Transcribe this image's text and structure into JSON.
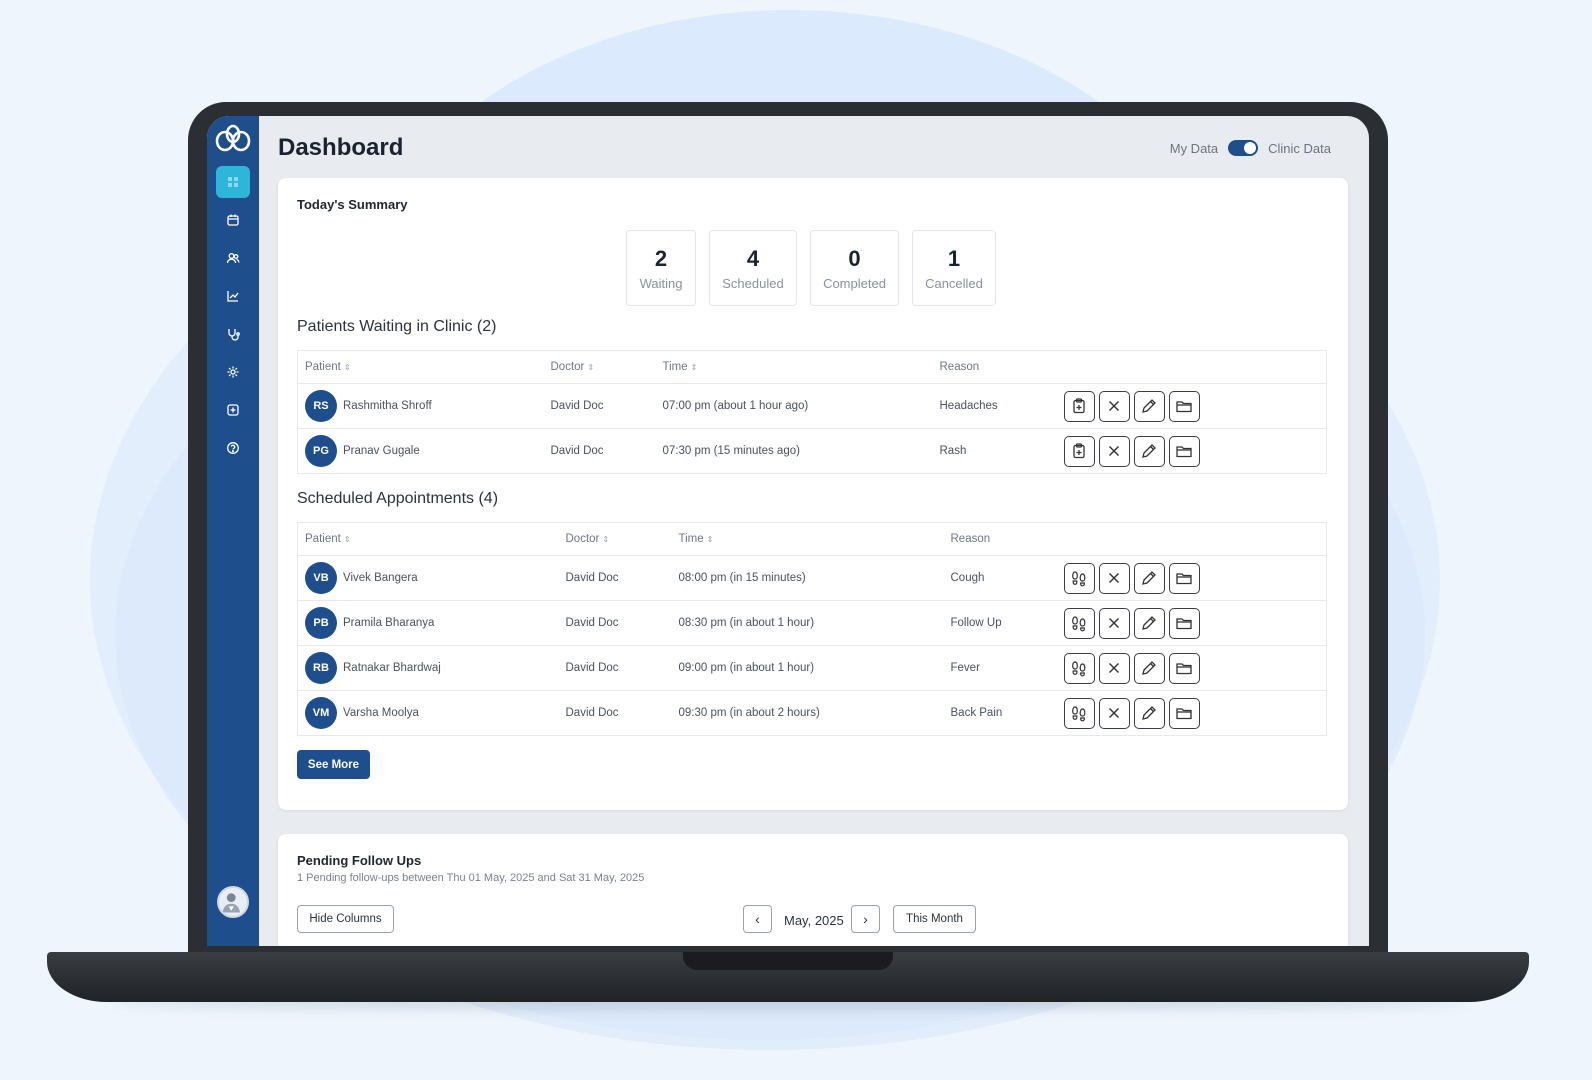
{
  "header": {
    "title": "Dashboard",
    "toggle_left": "My Data",
    "toggle_right": "Clinic Data"
  },
  "summary": {
    "title": "Today's Summary",
    "stats": [
      {
        "value": "2",
        "label": "Waiting"
      },
      {
        "value": "4",
        "label": "Scheduled"
      },
      {
        "value": "0",
        "label": "Completed"
      },
      {
        "value": "1",
        "label": "Cancelled"
      }
    ]
  },
  "waiting": {
    "title": "Patients Waiting in Clinic (2)",
    "columns": {
      "patient": "Patient",
      "doctor": "Doctor",
      "time": "Time",
      "reason": "Reason"
    },
    "rows": [
      {
        "initials": "RS",
        "name": "Rashmitha Shroff",
        "doctor": "David Doc",
        "time": "07:00 pm (about 1 hour ago)",
        "reason": "Headaches"
      },
      {
        "initials": "PG",
        "name": "Pranav Gugale",
        "doctor": "David Doc",
        "time": "07:30 pm (15 minutes ago)",
        "reason": "Rash"
      }
    ]
  },
  "scheduled": {
    "title": "Scheduled Appointments (4)",
    "columns": {
      "patient": "Patient",
      "doctor": "Doctor",
      "time": "Time",
      "reason": "Reason"
    },
    "rows": [
      {
        "initials": "VB",
        "name": "Vivek Bangera",
        "doctor": "David Doc",
        "time": "08:00 pm (in 15 minutes)",
        "reason": "Cough"
      },
      {
        "initials": "PB",
        "name": "Pramila Bharanya",
        "doctor": "David Doc",
        "time": "08:30 pm (in about 1 hour)",
        "reason": "Follow Up"
      },
      {
        "initials": "RB",
        "name": "Ratnakar Bhardwaj",
        "doctor": "David Doc",
        "time": "09:00 pm (in about 1 hour)",
        "reason": "Fever"
      },
      {
        "initials": "VM",
        "name": "Varsha Moolya",
        "doctor": "David Doc",
        "time": "09:30 pm (in about 2 hours)",
        "reason": "Back Pain"
      }
    ],
    "see_more": "See More"
  },
  "followups": {
    "title": "Pending Follow Ups",
    "subtitle": "1 Pending follow-ups between Thu 01 May, 2025 and Sat 31 May, 2025",
    "hide_columns": "Hide Columns",
    "month": "May, 2025",
    "prev": "‹",
    "next": "›",
    "this_month": "This Month"
  },
  "colors": {
    "brand": "#1f4e8c",
    "accent": "#2fb5d8",
    "late": "#c0504d"
  },
  "icons": [
    "dashboard-icon",
    "calendar-icon",
    "users-icon",
    "chart-icon",
    "stethoscope-icon",
    "settings-icon",
    "plus-box-icon",
    "help-icon"
  ]
}
